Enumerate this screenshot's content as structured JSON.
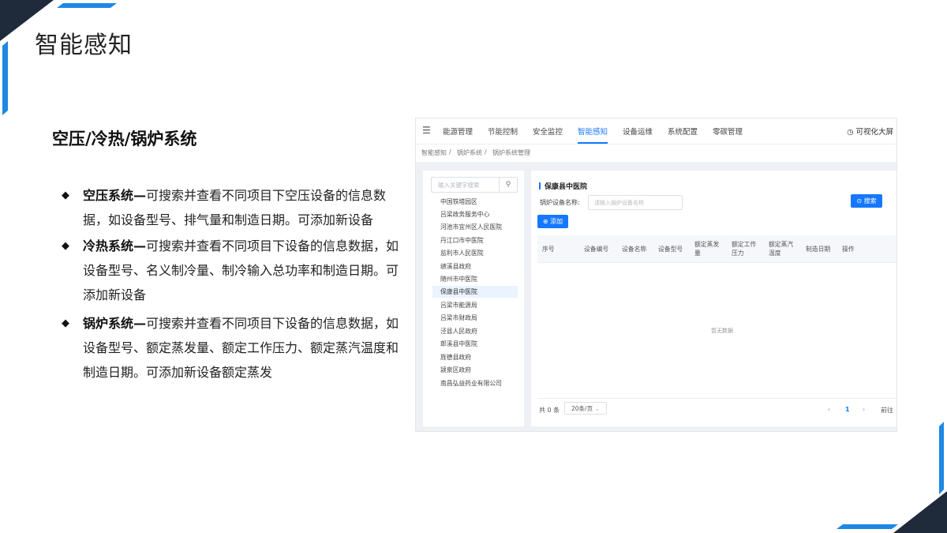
{
  "slide": {
    "title": "智能感知",
    "section_title": "空压/冷热/锅炉系统"
  },
  "bullets": [
    {
      "head": "空压系统—",
      "text": "可搜索并查看不同项目下空压设备的信息数据，如设备型号、排气量和制造日期。可添加新设备"
    },
    {
      "head": "冷热系统—",
      "text": "可搜索并查看不同项目下设备的信息数据，如设备型号、名义制冷量、制冷输入总功率和制造日期。可添加新设备"
    },
    {
      "head": "锅炉系统—",
      "text": "可搜索并查看不同项目下设备的信息数据，如设备型号、额定蒸发量、额定工作压力、额定蒸汽温度和制造日期。可添加新设备额定蒸发"
    }
  ],
  "app": {
    "nav": [
      "能源管理",
      "节能控制",
      "安全监控",
      "智能感知",
      "设备运维",
      "系统配置",
      "零碳管理"
    ],
    "active_nav": "智能感知",
    "viz_label": "◷ 可视化大屏",
    "breadcrumb": [
      "智能感知",
      "/",
      "锅炉系统",
      "/",
      "锅炉系统管理"
    ],
    "tree_search_placeholder": "输入关键字搜索",
    "tree_items": [
      "中国铁塔园区",
      "吕梁政务服务中心",
      "河池市宜州区人民医院",
      "丹江口市中医院",
      "监利市人民医院",
      "绩溪县政府",
      "随州市中医院",
      "保康县中医院",
      "吕梁市能源局",
      "吕梁市财政局",
      "泾县人民政府",
      "郎溪县中医院",
      "旌德县政府",
      "颍泉区政府",
      "南昌弘益药业有限公司"
    ],
    "selected_tree_item": "保康县中医院",
    "panel_title": "保康县中医院",
    "filter_label": "锅炉设备名称:",
    "filter_placeholder": "请输入锅炉设备名称",
    "search_button": "⊙ 搜索",
    "add_button": "⊕ 添加",
    "columns": [
      "序号",
      "设备编号",
      "设备名称",
      "设备型号",
      "额定蒸发量",
      "额定工作压力",
      "额定蒸汽温度",
      "制造日期",
      "操作"
    ],
    "empty_text": "暂无数据",
    "total_text": "共 0 条",
    "page_size": "20条/页",
    "prev": "‹",
    "current_page": "1",
    "next": "›",
    "goto": "前往"
  },
  "colors": {
    "accent": "#1677ff",
    "corner_dark": "#1f2a3a",
    "corner_blue": "#1e88e5"
  }
}
